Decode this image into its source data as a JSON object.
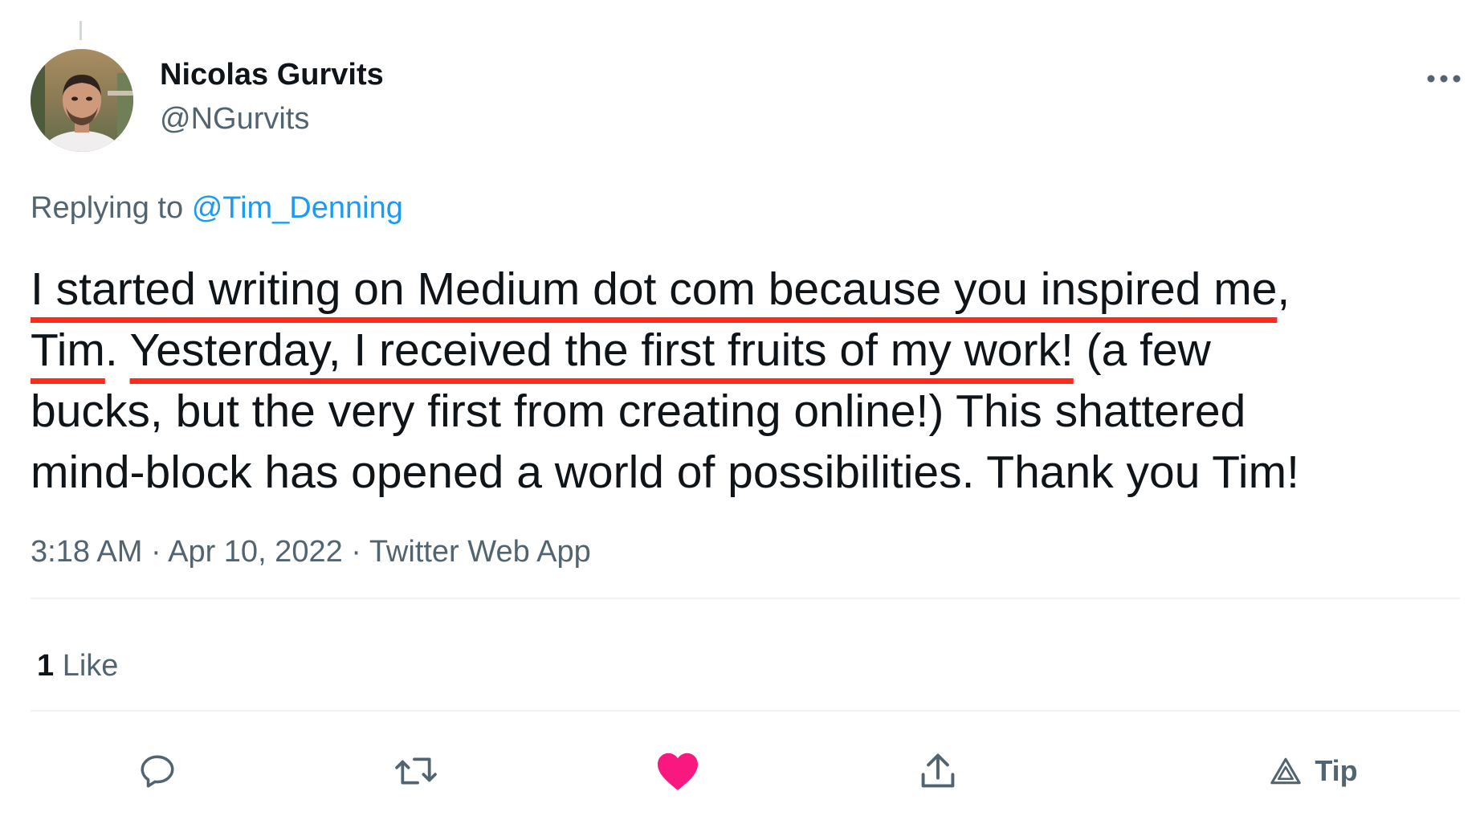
{
  "tweet": {
    "author": {
      "display_name": "Nicolas Gurvits",
      "handle": "@NGurvits"
    },
    "reply_prefix": "Replying to",
    "reply_to": "@Tim_Denning",
    "text_lines": [
      [
        {
          "text": "I started writing on Medium dot com because you inspired me",
          "marked": true
        },
        {
          "text": ",",
          "marked": false
        }
      ],
      [
        {
          "text": "Tim",
          "marked": true
        },
        {
          "text": ". ",
          "marked": false
        },
        {
          "text": "Yesterday, I received the first fruits of my work!",
          "marked": true
        },
        {
          "text": " (a few",
          "marked": false
        }
      ],
      [
        {
          "text": "bucks, but the very first from creating online!) This shattered",
          "marked": false
        }
      ],
      [
        {
          "text": "mind-block has opened a world of possibilities. Thank you Tim!",
          "marked": false
        }
      ]
    ],
    "time": "3:18 AM",
    "separator": "·",
    "date": "Apr 10, 2022",
    "source": "Twitter Web App",
    "like_count": "1",
    "like_label": "Like"
  },
  "actions": {
    "tip_label": "Tip"
  },
  "colors": {
    "mention": "#1d9bf0",
    "secondary_text": "#536471",
    "like_active": "#f91880",
    "annotation_underline": "#ff2a1a"
  }
}
